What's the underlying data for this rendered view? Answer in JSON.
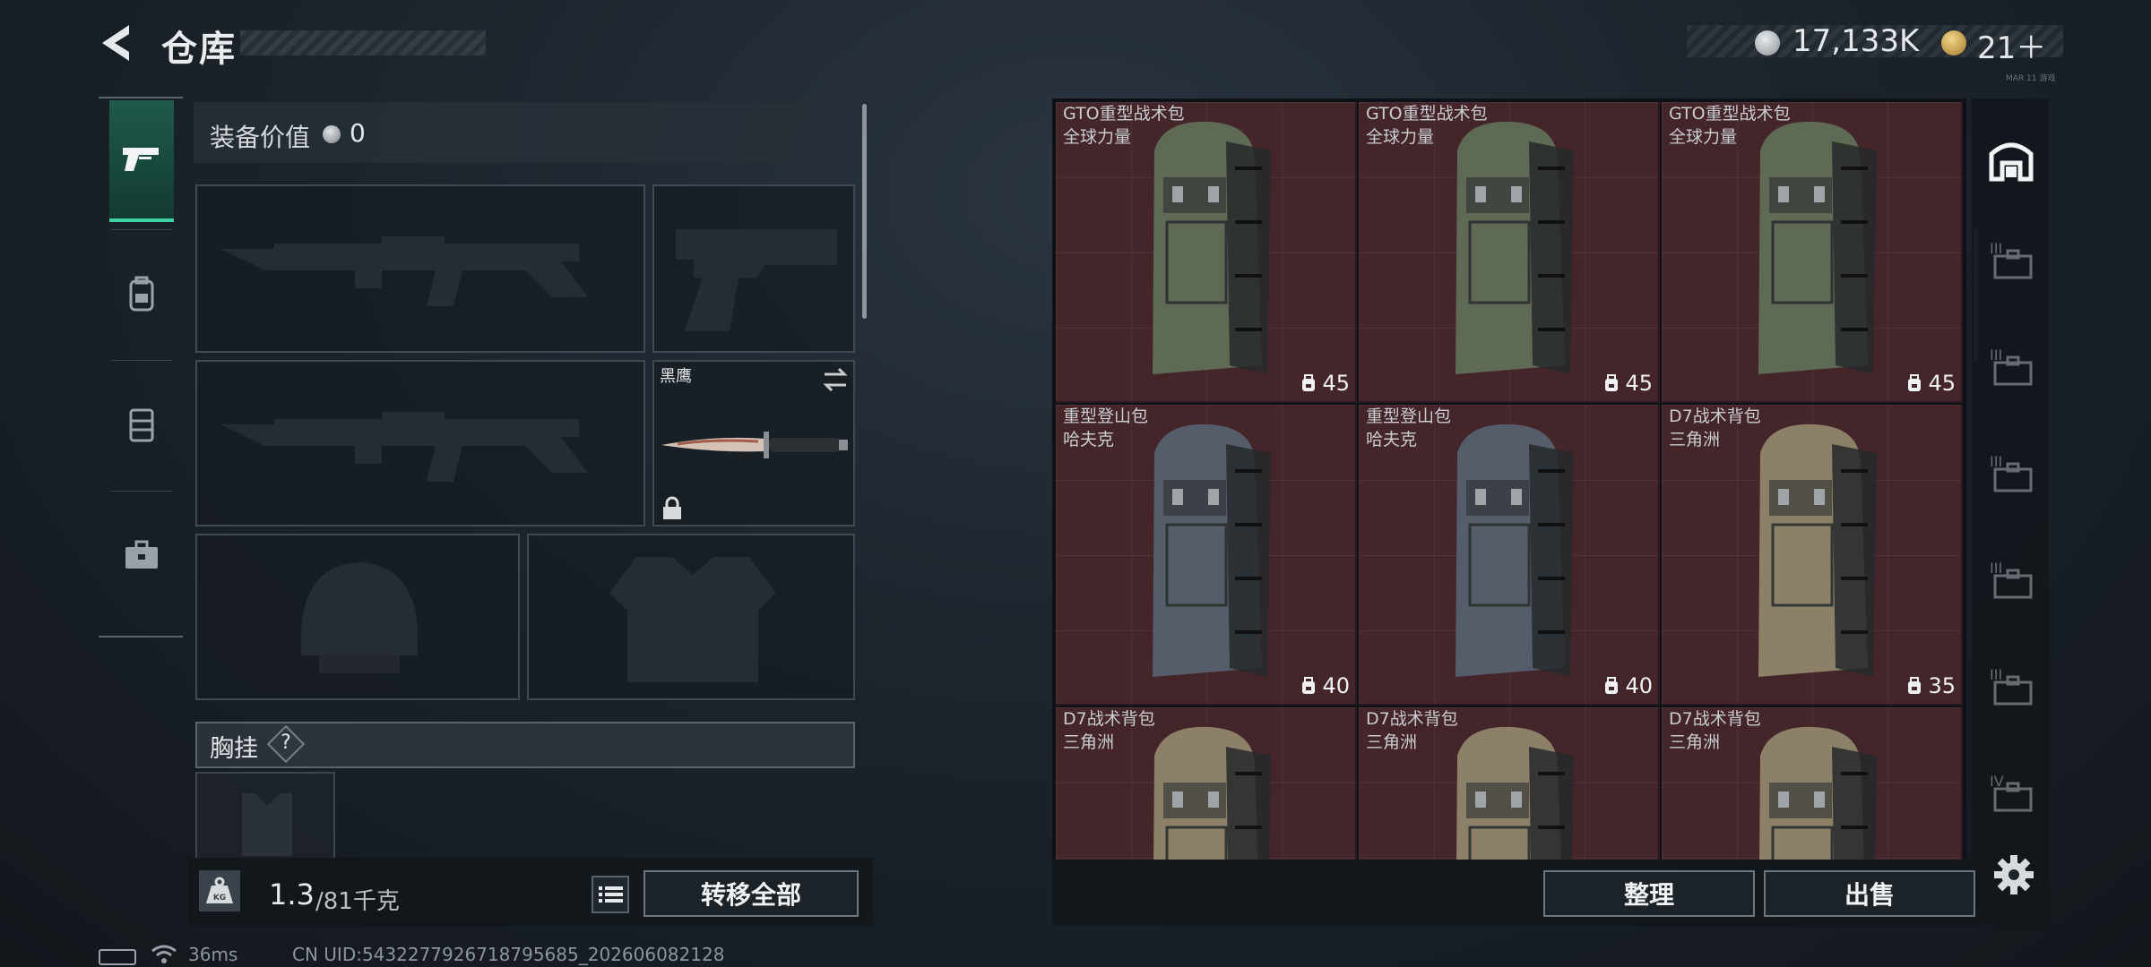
{
  "header": {
    "title": "仓库",
    "silver_value": "17,133K",
    "gold_value": "21＋",
    "tiny_label": "MAR 11 游戏"
  },
  "equipment": {
    "value_label": "装备价值",
    "value": "0",
    "knife_name": "黑鹰",
    "chest_label": "胸挂",
    "chest_help": "?"
  },
  "weight": {
    "current": "1.3",
    "max": "/81千克",
    "kg_icon_text": "KG"
  },
  "actions": {
    "transfer_all": "转移全部",
    "sort": "整理",
    "sell": "出售"
  },
  "status": {
    "ping": "36ms",
    "uid": "CN UID:5432277926718795685_202606082128"
  },
  "warehouse_items": [
    {
      "name": "GTO重型战术包",
      "brand": "全球力量",
      "capacity": "45",
      "color": "#5f6a55"
    },
    {
      "name": "GTO重型战术包",
      "brand": "全球力量",
      "capacity": "45",
      "color": "#5f6a55"
    },
    {
      "name": "GTO重型战术包",
      "brand": "全球力量",
      "capacity": "45",
      "color": "#5f6a55"
    },
    {
      "name": "重型登山包",
      "brand": "哈夫克",
      "capacity": "40",
      "color": "#555c6a"
    },
    {
      "name": "重型登山包",
      "brand": "哈夫克",
      "capacity": "40",
      "color": "#555c6a"
    },
    {
      "name": "D7战术背包",
      "brand": "三角洲",
      "capacity": "35",
      "color": "#8c8168"
    },
    {
      "name": "D7战术背包",
      "brand": "三角洲",
      "capacity": "",
      "color": "#8c8168"
    },
    {
      "name": "D7战术背包",
      "brand": "三角洲",
      "capacity": "",
      "color": "#8c8168"
    },
    {
      "name": "D7战术背包",
      "brand": "三角洲",
      "capacity": "",
      "color": "#8c8168"
    }
  ],
  "side_tiers": [
    "III",
    "III",
    "III",
    "III",
    "III",
    "IV"
  ],
  "colors": {
    "accent": "#3fd1a2",
    "cell_bg": "#43252a"
  }
}
